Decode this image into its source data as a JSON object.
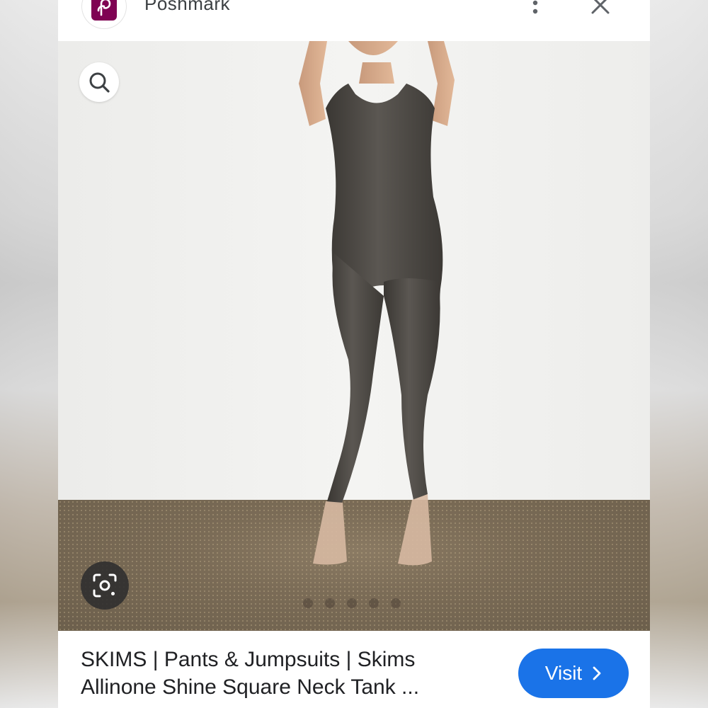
{
  "header": {
    "site_name": "Poshmark",
    "logo_icon": "poshmark-logo-icon",
    "logo_color": "#7f0353"
  },
  "image": {
    "description_icon": "product-photo",
    "carousel_dot_count": 5
  },
  "result": {
    "title_line_1": "SKIMS | Pants & Jumpsuits | Skims",
    "title_line_2": "Allinone Shine Square Neck Tank ...",
    "visit_label": "Visit",
    "accent_color": "#1a73e8"
  }
}
